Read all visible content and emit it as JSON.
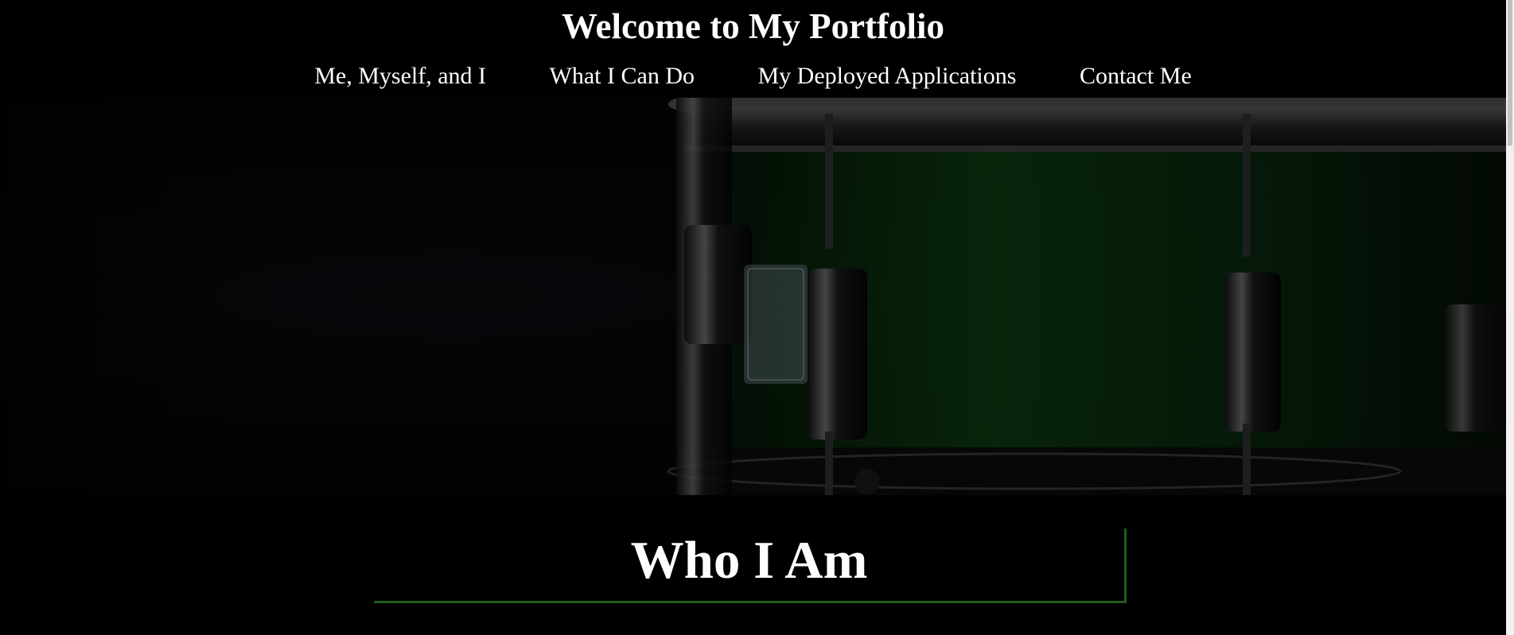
{
  "header": {
    "title": "Welcome to My Portfolio"
  },
  "nav": {
    "items": [
      {
        "label": "Me, Myself, and I"
      },
      {
        "label": "What I Can Do"
      },
      {
        "label": "My Deployed Applications"
      },
      {
        "label": "Contact Me"
      }
    ]
  },
  "hero": {
    "image_subject": "snare-drum",
    "drum_color": "#0f4a12"
  },
  "about": {
    "heading": "Who I Am",
    "accent_color": "#1f5c1a"
  }
}
